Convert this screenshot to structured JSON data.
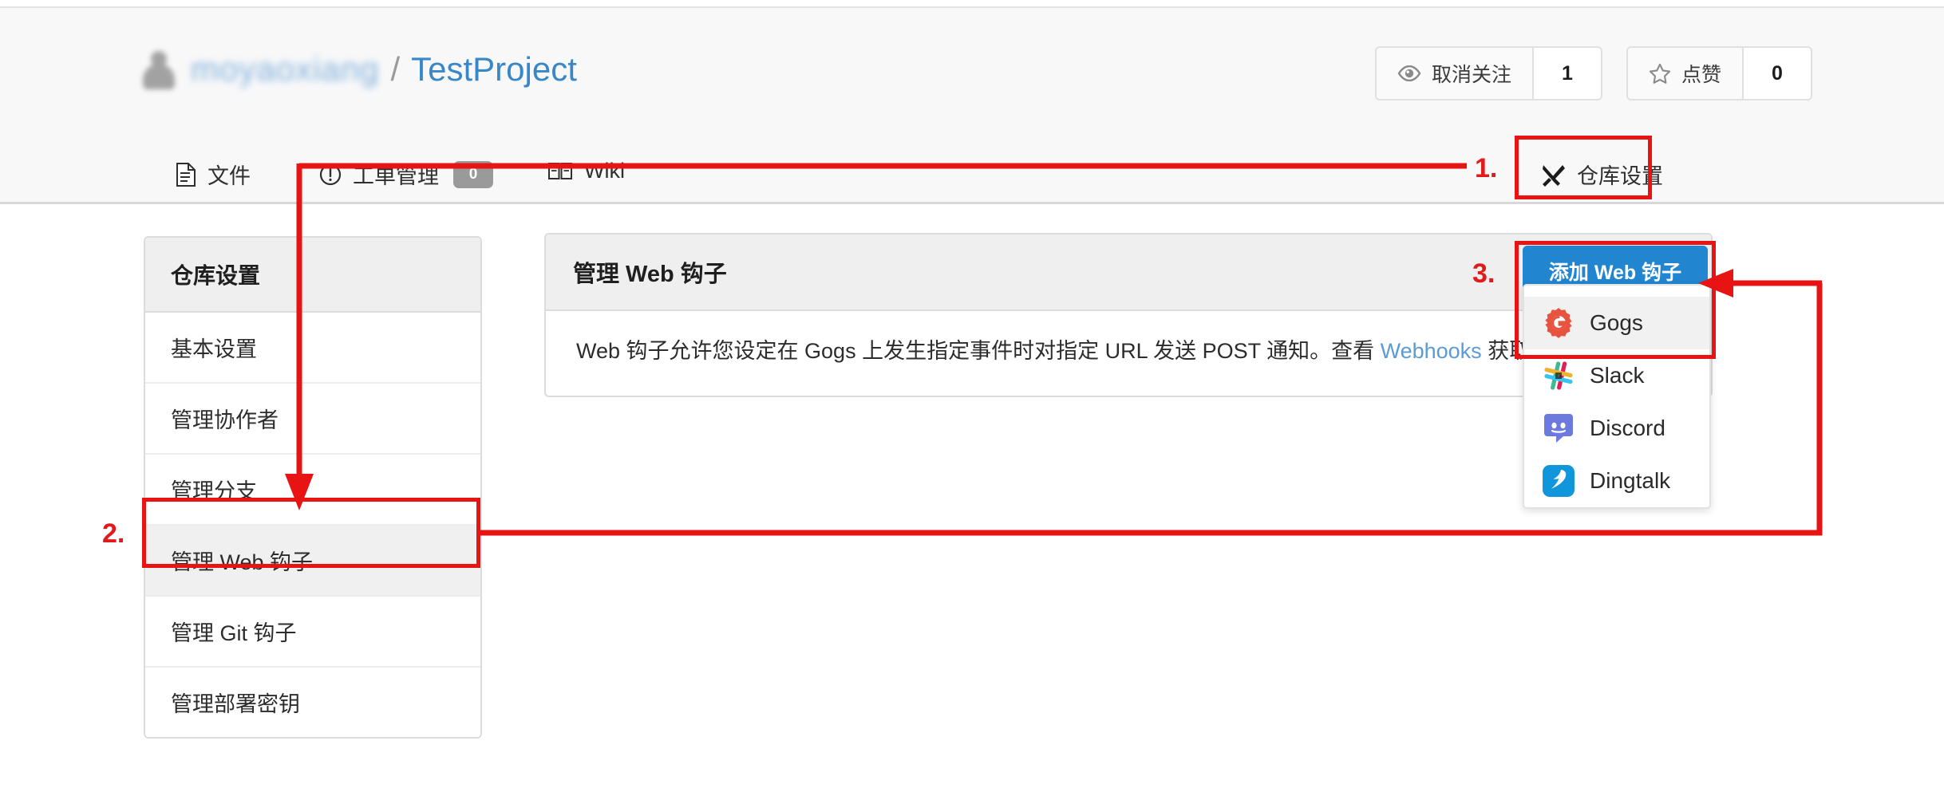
{
  "repo_header": {
    "owner_redacted": "moyaoxiang",
    "separator": "/",
    "repo_name": "TestProject",
    "watch": {
      "label": "取消关注",
      "count": "1",
      "icon": "eye-icon"
    },
    "star": {
      "label": "点赞",
      "count": "0",
      "icon": "star-icon"
    }
  },
  "nav_tabs": [
    {
      "label": "文件",
      "icon": "file-icon",
      "name": "tab-files"
    },
    {
      "label": "工单管理",
      "icon": "issue-icon",
      "badge": "0",
      "name": "tab-issues"
    },
    {
      "label": "Wiki",
      "icon": "book-icon",
      "name": "tab-wiki"
    },
    {
      "label": "仓库设置",
      "icon": "tools-icon",
      "name": "tab-settings"
    }
  ],
  "sidebar": {
    "header": "仓库设置",
    "items": [
      {
        "label": "基本设置",
        "active": false
      },
      {
        "label": "管理协作者",
        "active": false
      },
      {
        "label": "管理分支",
        "active": false
      },
      {
        "label": "管理 Web 钩子",
        "active": true
      },
      {
        "label": "管理 Git 钩子",
        "active": false
      },
      {
        "label": "管理部署密钥",
        "active": false
      }
    ]
  },
  "panel": {
    "title": "管理 Web 钩子",
    "description_before_link": "Web 钩子允许您设定在 Gogs 上发生指定事件时对指定 URL 发送 POST 通知。查看 ",
    "description_link": "Webhooks",
    "description_after_link": " 获取更多信息。"
  },
  "dropdown": {
    "button_label": "添加 Web 钩子",
    "items": [
      {
        "label": "Gogs",
        "icon": "gogs-icon",
        "selected": true
      },
      {
        "label": "Slack",
        "icon": "slack-icon",
        "selected": false
      },
      {
        "label": "Discord",
        "icon": "discord-icon",
        "selected": false
      },
      {
        "label": "Dingtalk",
        "icon": "dingtalk-icon",
        "selected": false
      }
    ]
  },
  "annotations": {
    "step1": "1.",
    "step2": "2.",
    "step3": "3.",
    "color": "#e81414"
  }
}
